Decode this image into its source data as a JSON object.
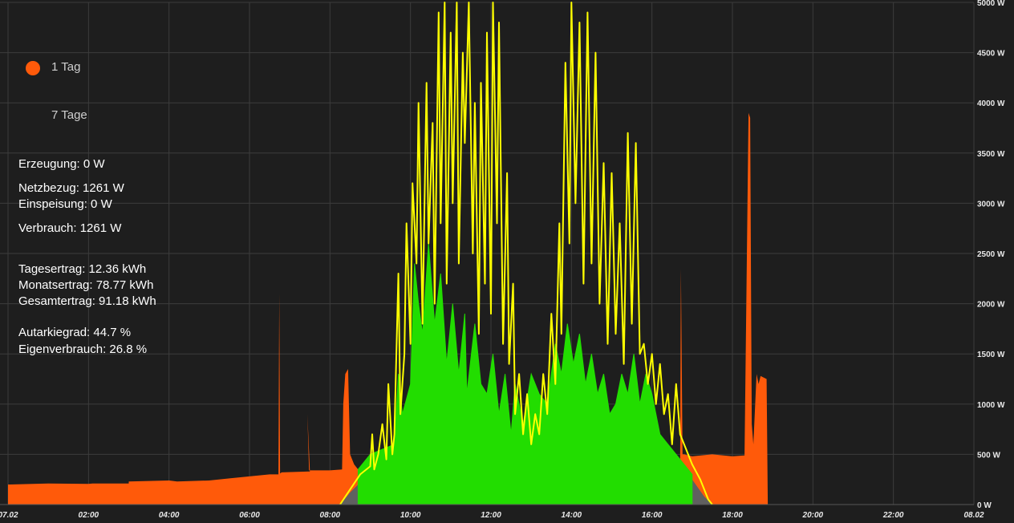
{
  "range_selector": {
    "options": [
      {
        "label": "1 Tag",
        "selected": true
      },
      {
        "label": "7 Tage",
        "selected": false
      }
    ],
    "selected_color": "#ff5a0a"
  },
  "stats": {
    "erzeugung": "Erzeugung: 0 W",
    "netzbezug": "Netzbezug: 1261 W",
    "einspeisung": "Einspeisung: 0 W",
    "verbrauch": "Verbrauch: 1261 W",
    "tagesertrag": "Tagesertrag: 12.36 kWh",
    "monatsertrag": "Monatsertrag: 78.77 kWh",
    "gesamtertrag": "Gesamtertrag: 91.18 kWh",
    "autarkiegrad": "Autarkiegrad: 44.7 %",
    "eigenverbrauch": "Eigenverbrauch: 26.8 %"
  },
  "colors": {
    "background": "#1e1e1e",
    "grid": "#3c3c3c",
    "netzbezug": "#ff5a0a",
    "eigenverbrauch": "#606060",
    "einspeisung": "#22dd00",
    "erzeugung": "#ffff00"
  },
  "chart_data": {
    "type": "area",
    "x_unit": "hour",
    "xlim": [
      0,
      24
    ],
    "ylim": [
      0,
      5000
    ],
    "y_ticks": [
      {
        "value": 0,
        "label": "0 W"
      },
      {
        "value": 500,
        "label": "500 W"
      },
      {
        "value": 1000,
        "label": "1000 W"
      },
      {
        "value": 1500,
        "label": "1500 W"
      },
      {
        "value": 2000,
        "label": "2000 W"
      },
      {
        "value": 2500,
        "label": "2500 W"
      },
      {
        "value": 3000,
        "label": "3000 W"
      },
      {
        "value": 3500,
        "label": "3500 W"
      },
      {
        "value": 4000,
        "label": "4000 W"
      },
      {
        "value": 4500,
        "label": "4500 W"
      },
      {
        "value": 5000,
        "label": "5000 W"
      }
    ],
    "x_ticks": [
      {
        "value": 0,
        "label": "07.02"
      },
      {
        "value": 2,
        "label": "02:00"
      },
      {
        "value": 4,
        "label": "04:00"
      },
      {
        "value": 6,
        "label": "06:00"
      },
      {
        "value": 8,
        "label": "08:00"
      },
      {
        "value": 10,
        "label": "10:00"
      },
      {
        "value": 12,
        "label": "12:00"
      },
      {
        "value": 14,
        "label": "14:00"
      },
      {
        "value": 16,
        "label": "16:00"
      },
      {
        "value": 18,
        "label": "18:00"
      },
      {
        "value": 20,
        "label": "20:00"
      },
      {
        "value": 22,
        "label": "22:00"
      },
      {
        "value": 24,
        "label": "08.02"
      }
    ],
    "grid": true,
    "series": [
      {
        "key": "netzbezug",
        "x": [
          0,
          0.05,
          1,
          2,
          2.1,
          3,
          3,
          4,
          4.2,
          5,
          5.5,
          6,
          6.5,
          6.72,
          6.74,
          6.76,
          6.8,
          7.5,
          7.44,
          7.48,
          8,
          8.3,
          8.33,
          8.38,
          8.45,
          8.5,
          8.6,
          8.7,
          8.8,
          8.9,
          9.0,
          16.6,
          16.7,
          16.72,
          16.76,
          16.8,
          17.0,
          17.5,
          18.0,
          18.3,
          18.4,
          18.44,
          18.48,
          18.52,
          18.6,
          18.65,
          18.7,
          18.85,
          18.88,
          18.9
        ],
        "y": [
          200,
          200,
          210,
          205,
          210,
          210,
          230,
          240,
          230,
          240,
          260,
          280,
          300,
          300,
          2100,
          310,
          320,
          330,
          900,
          340,
          340,
          350,
          1000,
          1300,
          1350,
          500,
          400,
          350,
          330,
          300,
          0,
          0,
          350,
          2350,
          500,
          500,
          480,
          500,
          480,
          490,
          3900,
          3850,
          800,
          600,
          1300,
          1200,
          1280,
          1250,
          0,
          0
        ]
      },
      {
        "key": "eigenverbrauch",
        "x": [
          8.25,
          8.5,
          9.0,
          9.5,
          10.0,
          10.5,
          11.0,
          11.3,
          11.4,
          11.6,
          11.7,
          12.0,
          13.0,
          14.0,
          15.0,
          16.0,
          16.5,
          17.0,
          17.3,
          17.5
        ],
        "y": [
          0,
          120,
          320,
          380,
          350,
          340,
          370,
          380,
          1100,
          1050,
          400,
          380,
          370,
          350,
          370,
          350,
          330,
          250,
          80,
          0
        ]
      },
      {
        "key": "einspeisung",
        "x": [
          8.7,
          9.0,
          9.3,
          9.6,
          9.7,
          9.8,
          10.0,
          10.1,
          10.2,
          10.3,
          10.45,
          10.6,
          10.75,
          10.9,
          11.05,
          11.2,
          11.35,
          11.4,
          11.6,
          11.75,
          11.9,
          12.05,
          12.2,
          12.35,
          12.5,
          12.6,
          12.8,
          13.0,
          13.2,
          13.4,
          13.6,
          13.75,
          13.9,
          14.05,
          14.2,
          14.35,
          14.5,
          14.65,
          14.8,
          14.95,
          15.1,
          15.25,
          15.4,
          15.55,
          15.7,
          15.85,
          16.0,
          16.2,
          16.4,
          16.6,
          16.8,
          17.0
        ],
        "y": [
          350,
          500,
          550,
          600,
          1300,
          900,
          1200,
          2400,
          2000,
          1700,
          2600,
          1800,
          2300,
          1400,
          2000,
          1300,
          1900,
          1100,
          1800,
          1200,
          1100,
          1500,
          900,
          1300,
          700,
          1200,
          800,
          1300,
          1100,
          1000,
          1600,
          1300,
          1800,
          1400,
          1700,
          1200,
          1500,
          1100,
          1300,
          900,
          1000,
          1300,
          1100,
          1500,
          1000,
          1300,
          1100,
          700,
          600,
          500,
          400,
          300
        ]
      },
      {
        "key": "erzeugung",
        "x": [
          8.25,
          8.5,
          8.75,
          9.0,
          9.05,
          9.1,
          9.2,
          9.3,
          9.4,
          9.45,
          9.55,
          9.6,
          9.7,
          9.75,
          9.85,
          9.9,
          10.0,
          10.05,
          10.15,
          10.2,
          10.3,
          10.4,
          10.45,
          10.55,
          10.6,
          10.7,
          10.75,
          10.85,
          10.9,
          11.0,
          11.05,
          11.15,
          11.2,
          11.3,
          11.35,
          11.45,
          11.55,
          11.6,
          11.7,
          11.75,
          11.85,
          11.9,
          12.0,
          12.05,
          12.15,
          12.2,
          12.3,
          12.4,
          12.45,
          12.55,
          12.6,
          12.7,
          12.8,
          12.9,
          13.0,
          13.1,
          13.2,
          13.3,
          13.4,
          13.5,
          13.6,
          13.7,
          13.75,
          13.85,
          13.95,
          14.0,
          14.1,
          14.2,
          14.3,
          14.4,
          14.5,
          14.6,
          14.7,
          14.8,
          14.9,
          15.0,
          15.1,
          15.2,
          15.3,
          15.4,
          15.5,
          15.6,
          15.7,
          15.8,
          15.9,
          16.0,
          16.1,
          16.2,
          16.3,
          16.4,
          16.5,
          16.6,
          16.7,
          16.8,
          16.9,
          17.0,
          17.2,
          17.4,
          17.5
        ],
        "y": [
          0,
          150,
          300,
          380,
          700,
          350,
          500,
          800,
          450,
          1200,
          500,
          700,
          2300,
          900,
          1500,
          2800,
          1600,
          3200,
          2400,
          4000,
          1800,
          4200,
          2600,
          3800,
          2000,
          4900,
          2800,
          5000,
          2200,
          4700,
          3000,
          5000,
          2400,
          4500,
          3600,
          5000,
          2500,
          4000,
          1700,
          4200,
          2200,
          4700,
          1900,
          5000,
          2800,
          4800,
          1600,
          3300,
          1400,
          2200,
          900,
          1300,
          700,
          1100,
          600,
          900,
          700,
          1300,
          900,
          1900,
          1200,
          2800,
          1700,
          4400,
          2600,
          5000,
          3000,
          4800,
          2200,
          4900,
          2400,
          4500,
          2000,
          3400,
          1600,
          3300,
          1700,
          2800,
          1400,
          3700,
          1800,
          3600,
          1500,
          1600,
          1200,
          1500,
          1000,
          1400,
          900,
          1100,
          600,
          1200,
          700,
          600,
          500,
          400,
          250,
          50,
          0
        ]
      }
    ]
  }
}
